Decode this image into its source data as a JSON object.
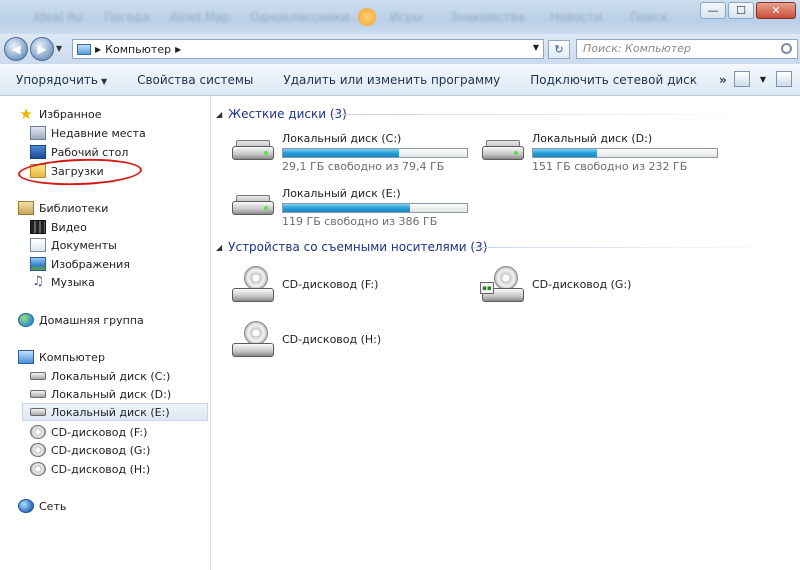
{
  "window": {
    "ghost_tabs": [
      "Ideal Ru",
      "Погода",
      "Ainet Map",
      "Одноклассники",
      "Игры",
      "Знакомства",
      "Новости",
      "Поиск"
    ],
    "controls": {
      "minimize": "—",
      "maximize": "☐",
      "close": "✕"
    }
  },
  "address": {
    "path": [
      "Компьютер"
    ],
    "search_placeholder": "Поиск: Компьютер"
  },
  "toolbar": {
    "organize": "Упорядочить",
    "system_properties": "Свойства системы",
    "uninstall": "Удалить или изменить программу",
    "map_drive": "Подключить сетевой диск",
    "more": "»"
  },
  "nav": {
    "favorites": "Избранное",
    "recent": "Недавние места",
    "desktop": "Рабочий стол",
    "downloads": "Загрузки",
    "libraries": "Библиотеки",
    "video": "Видео",
    "documents": "Документы",
    "pictures": "Изображения",
    "music": "Музыка",
    "homegroup": "Домашняя группа",
    "computer": "Компьютер",
    "drive_c": "Локальный диск (C:)",
    "drive_d": "Локальный диск (D:)",
    "drive_e": "Локальный диск (E:)",
    "cd_f": "CD-дисковод (F:)",
    "cd_g": "CD-дисковод (G:)",
    "cd_h": "CD-дисковод (H:)",
    "network": "Сеть"
  },
  "content": {
    "hdd_group": "Жесткие диски (3)",
    "removable_group": "Устройства со съемными носителями (3)",
    "drives": [
      {
        "name": "Локальный диск (C:)",
        "free": "29,1 ГБ свободно из 79,4 ГБ",
        "used_fraction": 0.63
      },
      {
        "name": "Локальный диск (D:)",
        "free": "151 ГБ свободно из 232 ГБ",
        "used_fraction": 0.35
      },
      {
        "name": "Локальный диск (E:)",
        "free": "119 ГБ свободно из 386 ГБ",
        "used_fraction": 0.69
      }
    ],
    "cds": [
      {
        "name": "CD-дисковод (F:)"
      },
      {
        "name": "CD-дисковод (G:)"
      },
      {
        "name": "CD-дисковод (H:)"
      }
    ]
  }
}
